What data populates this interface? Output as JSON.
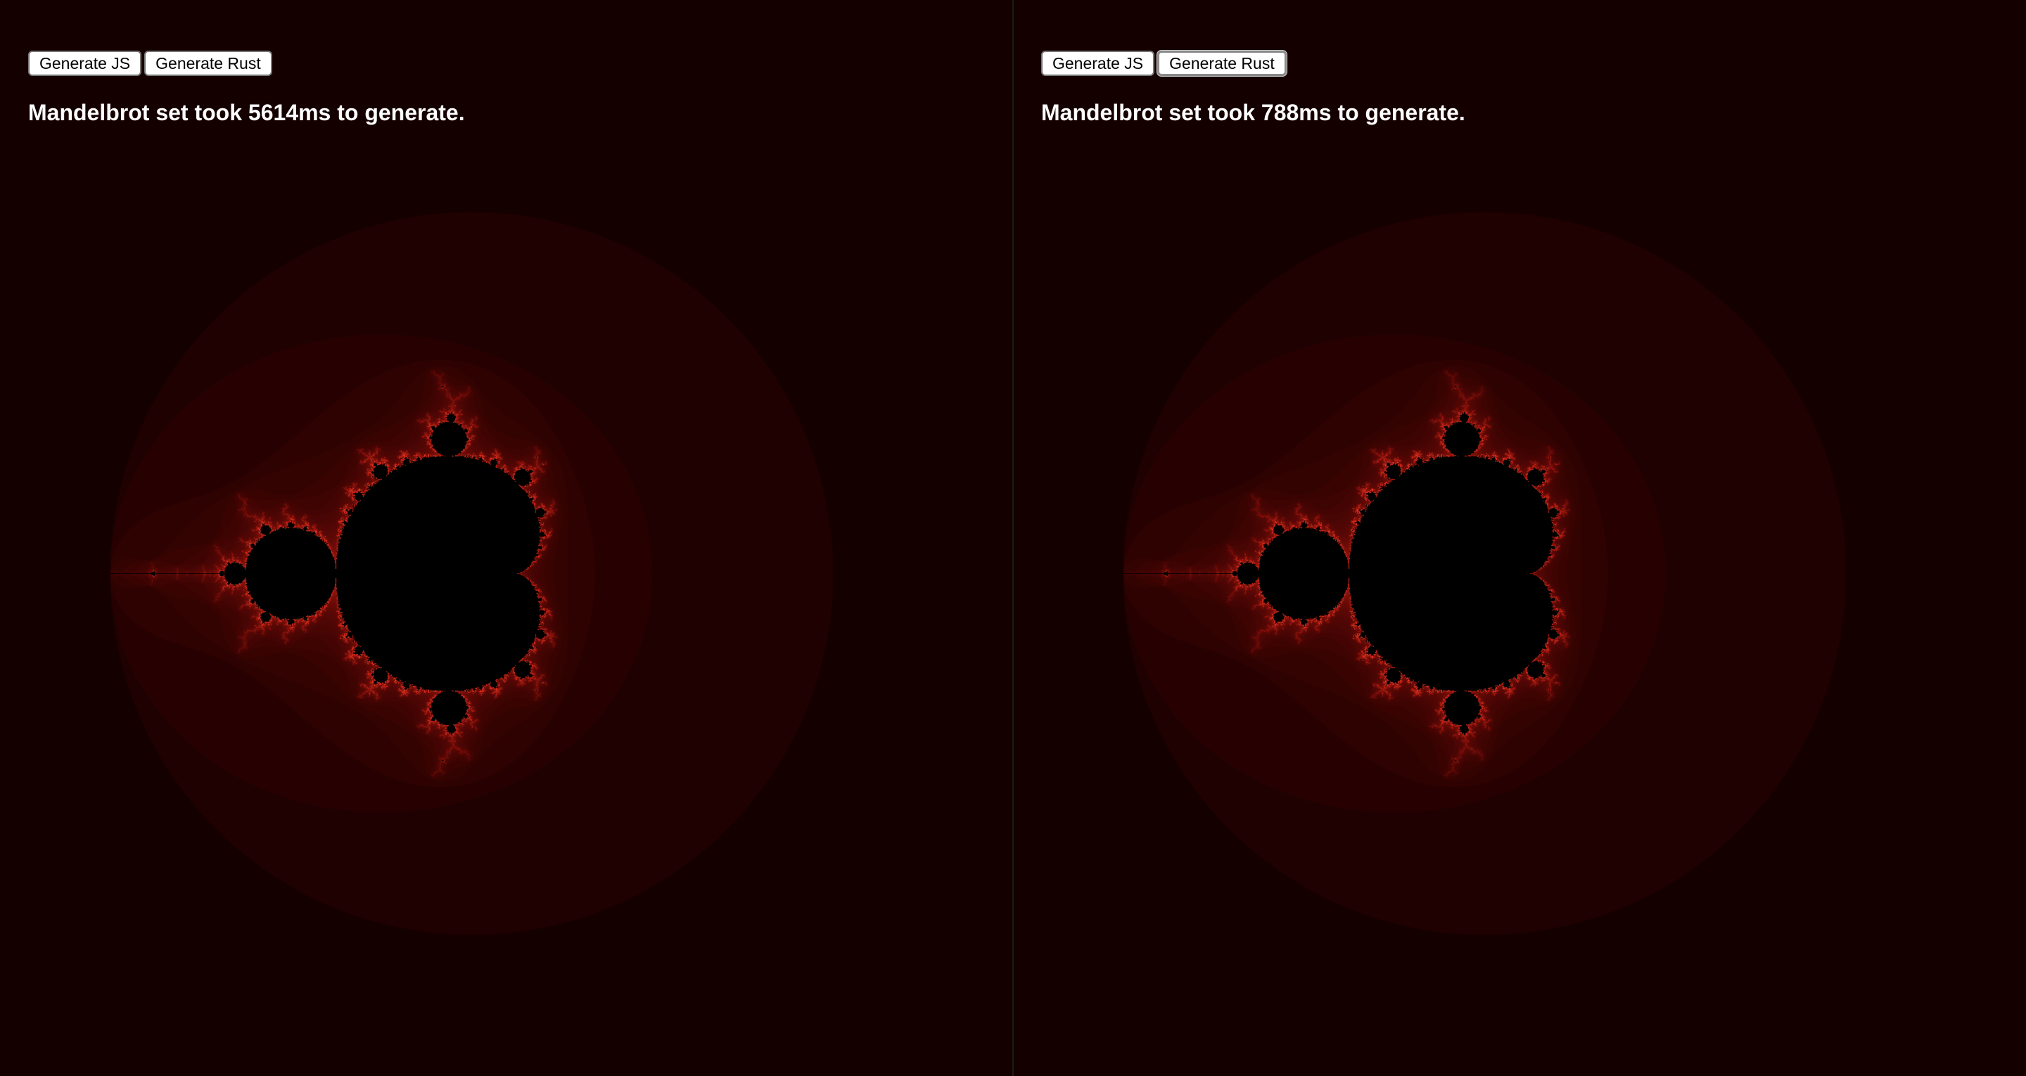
{
  "panels": [
    {
      "buttons": {
        "js_label": "Generate JS",
        "rust_label": "Generate Rust"
      },
      "status_text": "Mandelbrot set took 5614ms to generate.",
      "focused_button": "none"
    },
    {
      "buttons": {
        "js_label": "Generate JS",
        "rust_label": "Generate Rust"
      },
      "status_text": "Mandelbrot set took 788ms to generate.",
      "focused_button": "rust"
    }
  ],
  "colors": {
    "background": "#000000",
    "fractal_edge": "#e8321e",
    "text": "#ffffff"
  }
}
